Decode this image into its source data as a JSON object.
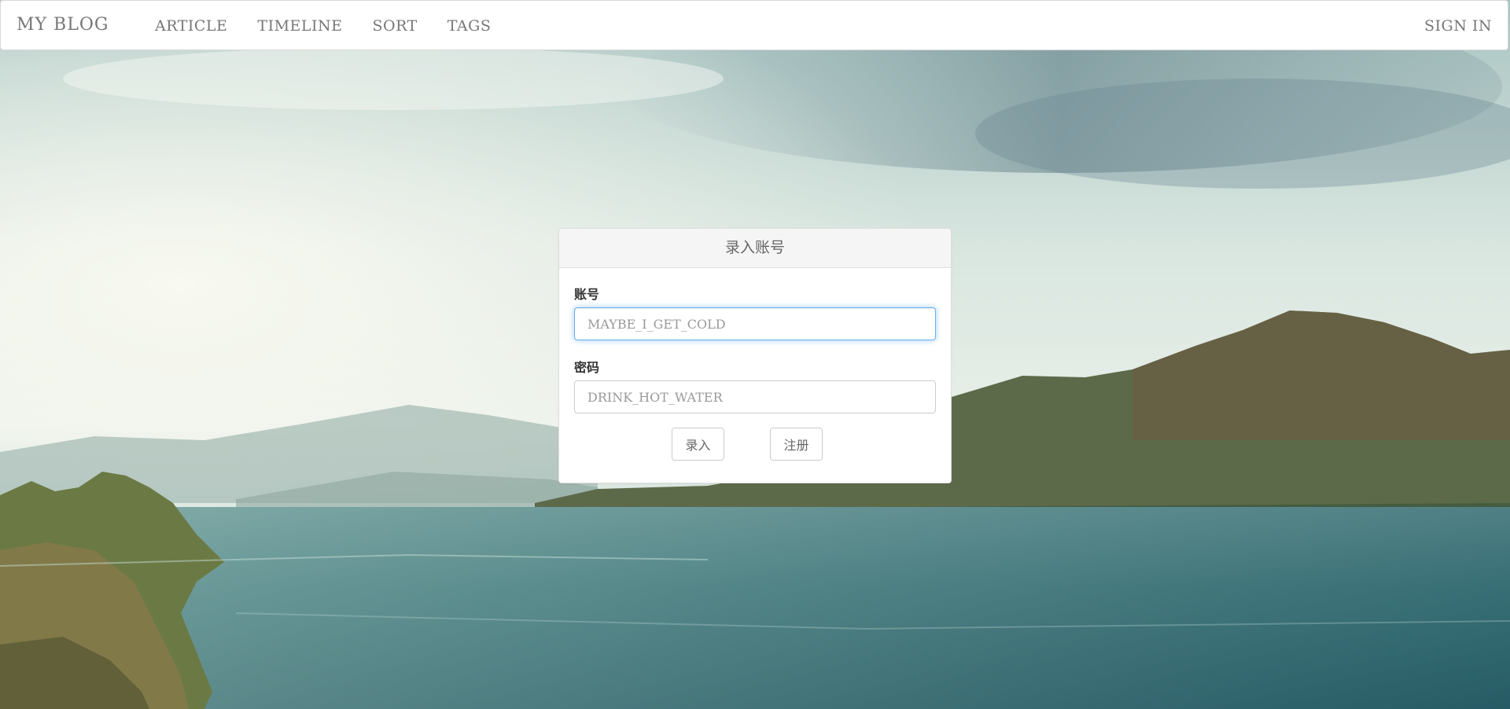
{
  "navbar": {
    "brand": "MY BLOG",
    "links": [
      "ARTICLE",
      "TIMELINE",
      "SORT",
      "TAGS"
    ],
    "sign_in": "SIGN IN"
  },
  "login_panel": {
    "title": "录入账号",
    "account_label": "账号",
    "account_placeholder": "MAYBE_I_GET_COLD",
    "password_label": "密码",
    "password_placeholder": "DRINK_HOT_WATER",
    "submit_label": "录入",
    "register_label": "注册"
  },
  "colors": {
    "navbar_bg": "#ffffff",
    "text_gray": "#777777",
    "focus_border": "#66afe9"
  }
}
